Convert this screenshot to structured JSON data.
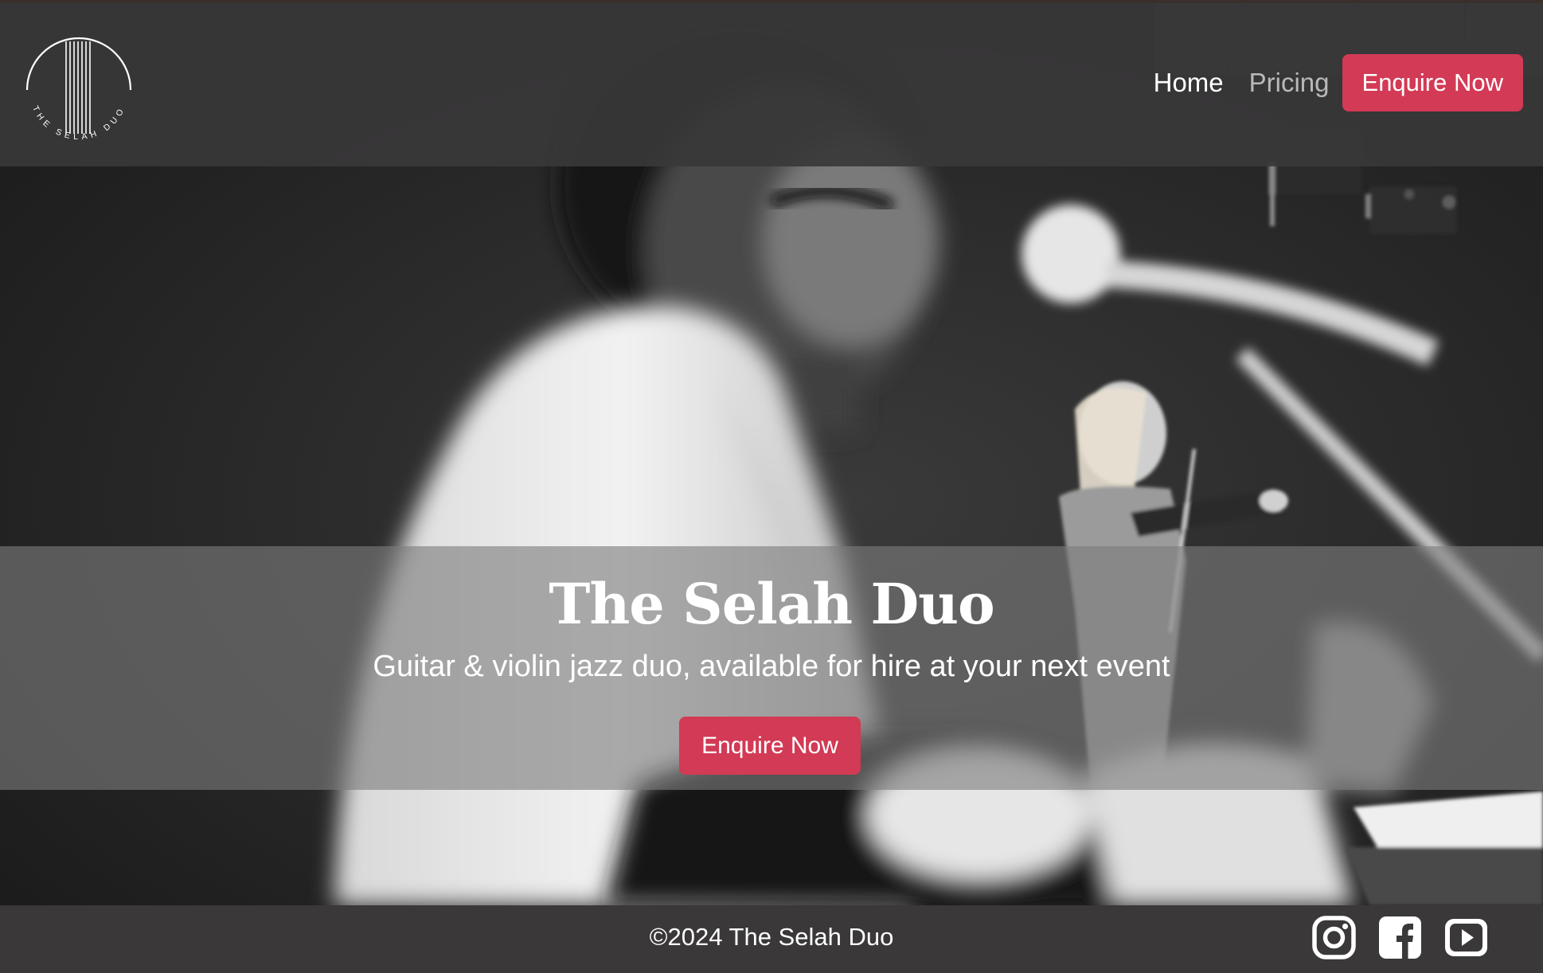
{
  "header": {
    "logo_text": "THE SELAH DUO",
    "nav": {
      "home": "Home",
      "pricing": "Pricing",
      "enquire": "Enquire Now"
    }
  },
  "hero": {
    "title": "The Selah Duo",
    "subtitle": "Guitar & violin jazz duo, available for hire at your next event",
    "cta": "Enquire Now",
    "image": "black-and-white photo of guitarist and violinist performing"
  },
  "footer": {
    "copyright": "©2024 The Selah Duo",
    "socials": [
      "instagram-icon",
      "facebook-icon",
      "youtube-icon"
    ]
  },
  "colors": {
    "accent": "#d23a55",
    "header_bg": "#3a3839",
    "footer_bg": "#3a3839"
  }
}
